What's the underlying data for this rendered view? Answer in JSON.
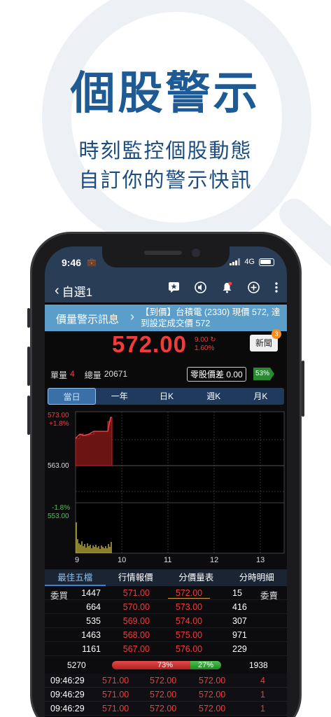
{
  "promo": {
    "title": "個股警示",
    "subtitle_line1": "時刻監控個股動態",
    "subtitle_line2": "自訂你的警示快訊"
  },
  "status_bar": {
    "time": "9:46",
    "network": "4G"
  },
  "nav": {
    "back_label": "自選1"
  },
  "alert": {
    "label": "價量警示訊息",
    "message": "【到價】台積電 (2330) 現價 572, 達到設定成交價 572"
  },
  "quote": {
    "price": "572.00",
    "change": "9.00",
    "change_pct": "1.60%",
    "news_label": "新聞",
    "news_count": "3",
    "unit_vol_label": "單量",
    "unit_vol": "4",
    "total_vol_label": "總量",
    "total_vol": "20671",
    "odd_lot_label": "零股價差",
    "odd_lot_value": "0.00",
    "ratio_tag": "53%"
  },
  "tabs": [
    "當日",
    "一年",
    "日K",
    "週K",
    "月K"
  ],
  "chart": {
    "price_top": "573.00",
    "pct_top": "+1.8%",
    "price_mid": "563.00",
    "pct_low": "-1.8%",
    "price_low": "553.00",
    "x_labels": [
      "9",
      "10",
      "11",
      "12",
      "13"
    ]
  },
  "sub_tabs": [
    "最佳五檔",
    "行情報價",
    "分價量表",
    "分時明細"
  ],
  "order_book": {
    "bid_label": "委買",
    "ask_label": "委賣",
    "rows": [
      {
        "bid_vol": "1447",
        "bid": "571.00",
        "ask": "572.00",
        "ask_vol": "15"
      },
      {
        "bid_vol": "664",
        "bid": "570.00",
        "ask": "573.00",
        "ask_vol": "416"
      },
      {
        "bid_vol": "535",
        "bid": "569.00",
        "ask": "574.00",
        "ask_vol": "307"
      },
      {
        "bid_vol": "1463",
        "bid": "568.00",
        "ask": "575.00",
        "ask_vol": "971"
      },
      {
        "bid_vol": "1161",
        "bid": "567.00",
        "ask": "576.00",
        "ask_vol": "229"
      }
    ],
    "total_bid": "5270",
    "bid_pct": "73%",
    "ask_pct": "27%",
    "total_ask": "1938"
  },
  "ticks": [
    {
      "time": "09:46:29",
      "bid": "571.00",
      "ask": "572.00",
      "price": "572.00",
      "vol": "4"
    },
    {
      "time": "09:46:29",
      "bid": "571.00",
      "ask": "572.00",
      "price": "572.00",
      "vol": "1"
    },
    {
      "time": "09:46:29",
      "bid": "571.00",
      "ask": "572.00",
      "price": "572.00",
      "vol": "1"
    }
  ],
  "colors": {
    "up": "#f23b3b",
    "down": "#2a8a34",
    "brand": "#1e5a94",
    "banner": "#5a9ec9"
  }
}
